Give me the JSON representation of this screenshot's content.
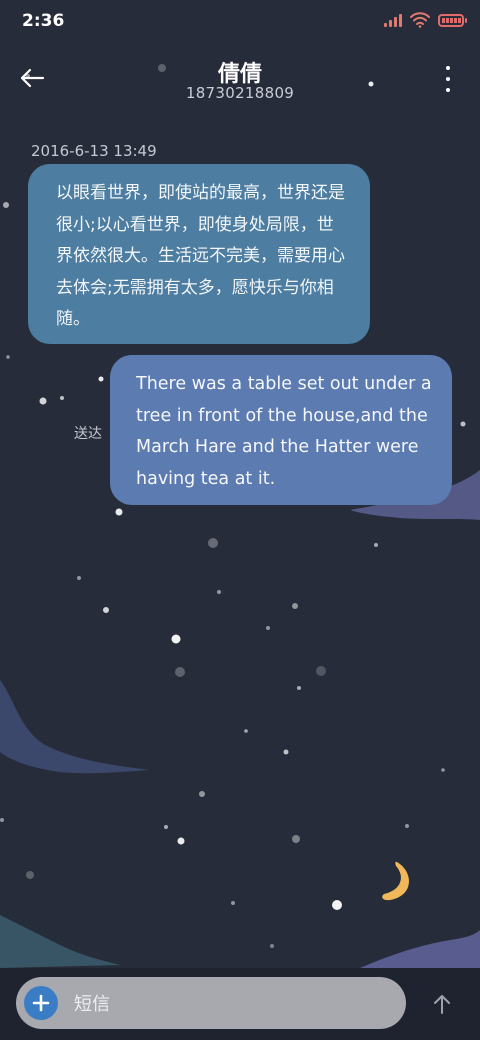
{
  "status_bar": {
    "time": "2:36",
    "icons": [
      "signal-icon",
      "wifi-icon",
      "battery-icon"
    ]
  },
  "header": {
    "contact_name": "倩倩",
    "phone_number": "18730218809",
    "back_icon": "arrow-left-icon",
    "more_icon": "more-vertical-icon"
  },
  "conversation": {
    "timestamp": "2016-6-13 13:49",
    "messages": [
      {
        "direction": "received",
        "text": "以眼看世界，即使站的最高，世界还是很小;以心看世界，即使身处局限，世界依然很大。生活远不完美，需要用心去体会;无需拥有太多，愿快乐与你相随。"
      },
      {
        "direction": "sent",
        "status": "送达",
        "text": "There was a table set out under a tree in front of the house,and the March Hare and the Hatter were having tea at it."
      }
    ]
  },
  "composer": {
    "placeholder": "短信",
    "add_icon": "plus-icon",
    "send_icon": "arrow-up-icon"
  },
  "colors": {
    "background": "#272c3a",
    "received_bubble": "#4d7da0",
    "sent_bubble": "#5c7bb0",
    "accent": "#3b7dc4",
    "moon": "#f1b85a"
  }
}
